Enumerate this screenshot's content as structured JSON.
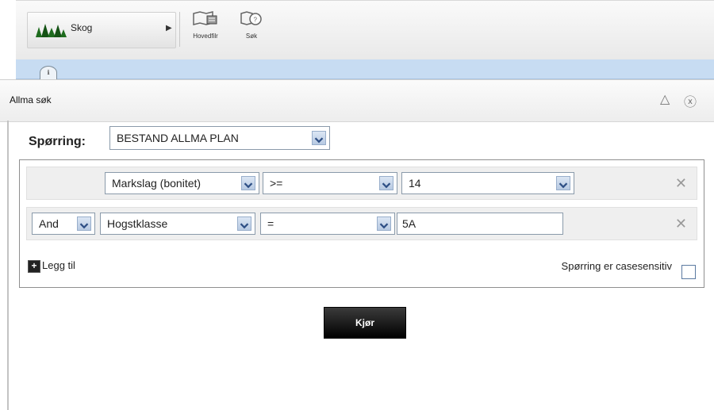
{
  "toolbar": {
    "layer_label": "Skog",
    "tools": [
      {
        "label": "Hovedfilr",
        "icon": "map-layers-icon"
      },
      {
        "label": "Søk",
        "icon": "search-map-icon"
      }
    ]
  },
  "dialog": {
    "title": "Allma søk",
    "query_label": "Spørring:",
    "query_value": "BESTAND ALLMA PLAN",
    "rows": [
      {
        "operator_logic": "",
        "field": "Markslag (bonitet)",
        "comparator": ">=",
        "value": "14",
        "value_is_select": true
      },
      {
        "operator_logic": "And",
        "field": "Hogstklasse",
        "comparator": "=",
        "value": "5A",
        "value_is_select": false
      }
    ],
    "add_label": "Legg til",
    "case_label": "Spørring er casesensitiv",
    "case_checked": false,
    "run_label": "Kjør"
  }
}
